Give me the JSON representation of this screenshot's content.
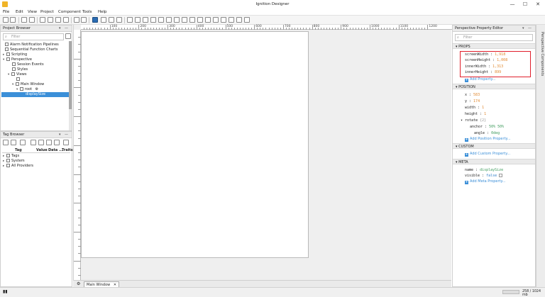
{
  "app": {
    "title": "Ignition Designer"
  },
  "window_controls": {
    "minimize": "—",
    "maximize": "☐",
    "close": "✕"
  },
  "menu": [
    "File",
    "Edit",
    "View",
    "Project",
    "Component",
    "Tools",
    "Help"
  ],
  "project_browser": {
    "title": "Project Browser",
    "filter_placeholder": "Filter",
    "items": [
      {
        "label": "Alarm Notification Pipelines"
      },
      {
        "label": "Sequential Function Charts"
      },
      {
        "label": "Scripting"
      },
      {
        "label": "Perspective"
      },
      {
        "label": "Session Events"
      },
      {
        "label": "Styles"
      },
      {
        "label": "Views"
      },
      {
        "label": "Main Window"
      },
      {
        "label": "root"
      },
      {
        "label": "displaySize"
      }
    ]
  },
  "tag_browser": {
    "title": "Tag Browser",
    "columns": [
      "Tag",
      "Value",
      "Data ...",
      "Traits"
    ],
    "rows": [
      {
        "label": "Tags"
      },
      {
        "label": "System"
      },
      {
        "label": "All Providers"
      }
    ]
  },
  "ruler": {
    "h_labels": [
      "100",
      "200",
      "300",
      "400",
      "500",
      "600",
      "700",
      "800",
      "900",
      "1000",
      "1100",
      "1200"
    ]
  },
  "bottom_tabs": {
    "main": "Main Window"
  },
  "status": {
    "memory": "258 / 1024 mb"
  },
  "property_editor": {
    "title": "Perspective Property Editor",
    "filter_placeholder": "Filter",
    "sections": {
      "props": "PROPS",
      "position": "POSITION",
      "custom": "CUSTOM",
      "meta": "META"
    },
    "props": [
      {
        "key": "screenWidth",
        "value": "1,918"
      },
      {
        "key": "screenHeight",
        "value": "1,008"
      },
      {
        "key": "innerWidth",
        "value": "1,313"
      },
      {
        "key": "innerHeight",
        "value": "899"
      }
    ],
    "position": [
      {
        "key": "x",
        "value": "583"
      },
      {
        "key": "y",
        "value": "174"
      },
      {
        "key": "width",
        "value": "1"
      },
      {
        "key": "height",
        "value": "1"
      },
      {
        "key": "rotate",
        "value": "{2}"
      },
      {
        "key": "anchor",
        "value": "50% 50%"
      },
      {
        "key": "angle",
        "value": "0deg"
      }
    ],
    "meta": [
      {
        "key": "name",
        "value": "displaySize"
      },
      {
        "key": "visible",
        "value": "false"
      }
    ],
    "add_property": "Add Property...",
    "add_position_property": "Add Position Property...",
    "add_custom_property": "Add Custom Property...",
    "add_meta_property": "Add Meta Property..."
  },
  "right_strip": {
    "label": "Perspective Components"
  },
  "colors": {
    "selection": "#3b8fd8",
    "highlight": "#e01e2b",
    "value": "#e0872d"
  }
}
